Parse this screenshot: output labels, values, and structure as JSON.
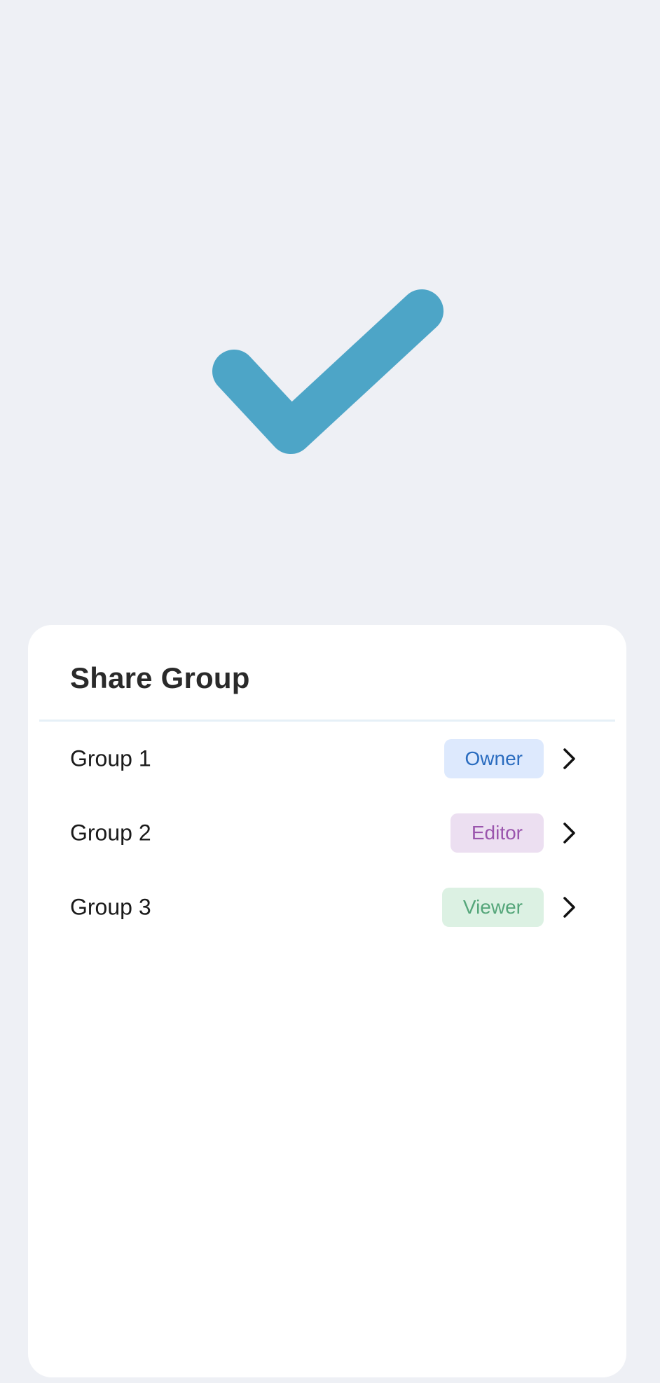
{
  "screen": {
    "background": "#eef0f5",
    "status_icon": "checkmark-icon",
    "status_icon_color": "#4da5c7"
  },
  "share_sheet": {
    "title": "Share Group",
    "groups": [
      {
        "name": "Group 1",
        "role": "Owner",
        "badge_bg": "#dde9fd",
        "badge_fg": "#2a6cbf",
        "icon": "chevron-right-icon"
      },
      {
        "name": "Group 2",
        "role": "Editor",
        "badge_bg": "#ecdff1",
        "badge_fg": "#9a55ad",
        "icon": "chevron-right-icon"
      },
      {
        "name": "Group 3",
        "role": "Viewer",
        "badge_bg": "#dcf1e3",
        "badge_fg": "#55a67a",
        "icon": "chevron-right-icon"
      }
    ]
  }
}
